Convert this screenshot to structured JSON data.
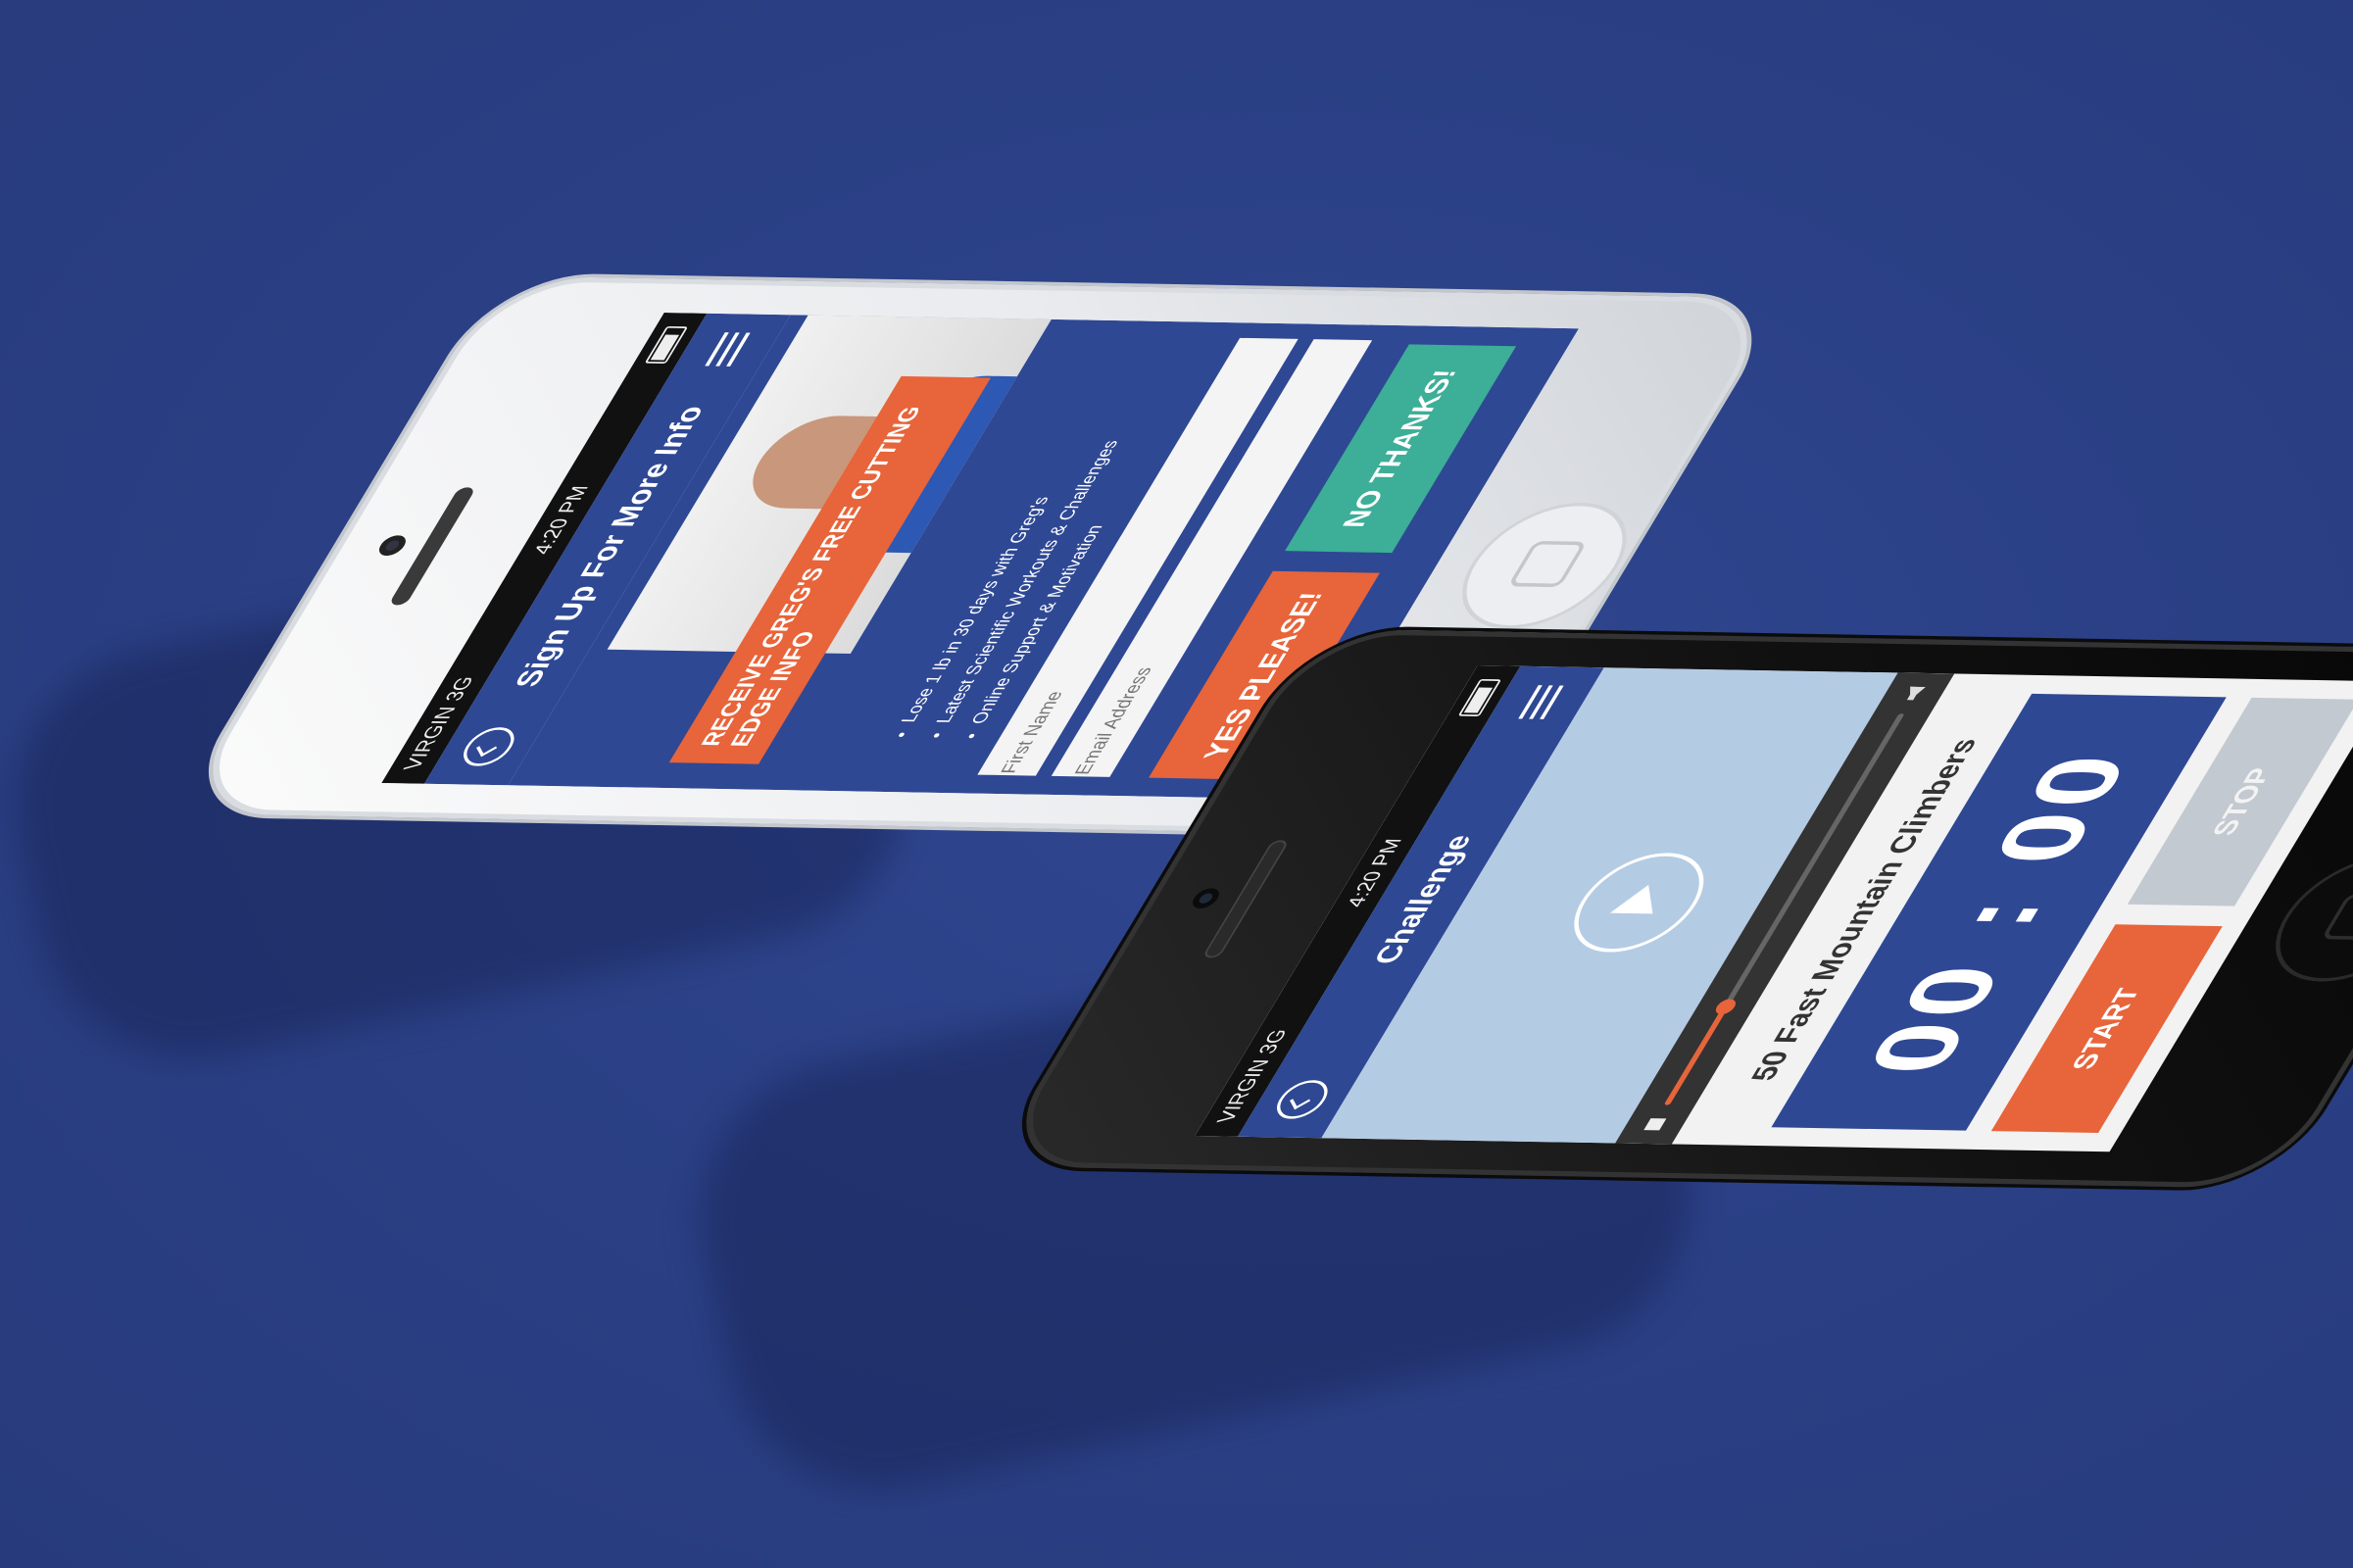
{
  "colors": {
    "background": "#2b4186",
    "brand_blue": "#2e4894",
    "accent_orange": "#e8643a",
    "accent_green": "#3dae97",
    "video_blue": "#b4cbe4",
    "disabled_gray": "#c3c9d1"
  },
  "white_phone": {
    "status": {
      "carrier": "VIRGIN 3G",
      "time": "4:20 PM"
    },
    "nav": {
      "title": "Sign Up For More Info",
      "back_icon": "back-icon",
      "menu_icon": "menu-icon"
    },
    "banner": "Receive Greg's free cutting edge info",
    "benefits": [
      "Lose 1 lb in 30 days with Greg's",
      "Latest Scientific Workouts & Challenges",
      "Online Support & Motivation"
    ],
    "inputs": {
      "first_name_placeholder": "First Name",
      "email_placeholder": "Email Address"
    },
    "buttons": {
      "yes": "Yes please!",
      "no": "No thanks!"
    }
  },
  "black_phone": {
    "status": {
      "carrier": "VIRGIN 3G",
      "time": "4:20 PM"
    },
    "nav": {
      "title": "Challenge",
      "back_icon": "back-icon",
      "menu_icon": "menu-icon"
    },
    "video": {
      "progress": 0.25,
      "play_icon": "play-icon"
    },
    "exercise_title": "50 Fast Mountain Climbers",
    "timer": "00 : 00",
    "buttons": {
      "start": "START",
      "stop": "STOP"
    }
  }
}
